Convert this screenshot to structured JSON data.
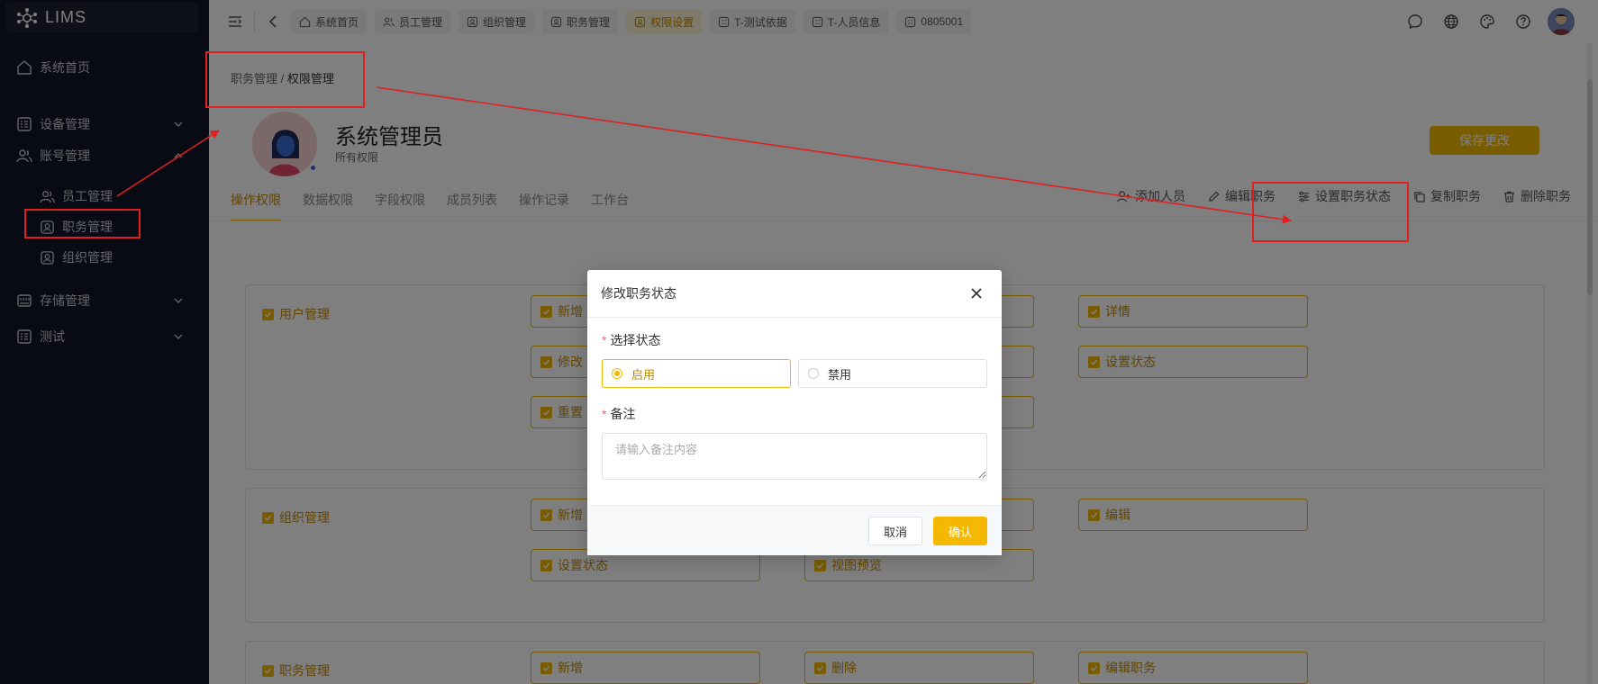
{
  "app": {
    "name": "LIMS"
  },
  "sidebar": {
    "items": [
      {
        "label": "系统首页"
      },
      {
        "label": "设备管理"
      },
      {
        "label": "账号管理"
      },
      {
        "label": "存储管理"
      },
      {
        "label": "测试"
      }
    ],
    "sub_items": [
      {
        "label": "员工管理"
      },
      {
        "label": "职务管理"
      },
      {
        "label": "组织管理"
      }
    ]
  },
  "topbar": {
    "tags": [
      {
        "label": "系统首页",
        "icon": "home-icon"
      },
      {
        "label": "员工管理",
        "icon": "users-icon"
      },
      {
        "label": "组织管理",
        "icon": "user-badge-icon"
      },
      {
        "label": "职务管理",
        "icon": "user-badge-icon"
      },
      {
        "label": "权限设置",
        "icon": "user-badge-icon",
        "active": true
      },
      {
        "label": "T-测试依据",
        "icon": "grid-icon"
      },
      {
        "label": "T-人员信息",
        "icon": "grid-icon"
      },
      {
        "label": "0805001",
        "icon": "grid-icon"
      }
    ]
  },
  "content": {
    "breadcrumb": {
      "parent": "职务管理",
      "separator": "/",
      "current": "权限管理"
    },
    "role": {
      "name": "系统管理员",
      "desc": "所有权限"
    },
    "save_label": "保存更改",
    "tabs": [
      "操作权限",
      "数据权限",
      "字段权限",
      "成员列表",
      "操作记录",
      "工作台"
    ],
    "actions": [
      {
        "label": "添加人员",
        "icon": "add-user-icon"
      },
      {
        "label": "编辑职务",
        "icon": "edit-icon"
      },
      {
        "label": "设置职务状态",
        "icon": "sliders-icon"
      },
      {
        "label": "复制职务",
        "icon": "copy-icon"
      },
      {
        "label": "删除职务",
        "icon": "trash-icon"
      }
    ],
    "groups": [
      {
        "title": "用户管理",
        "perms": [
          "新增",
          "",
          "详情",
          "修改",
          "",
          "设置状态",
          "重置",
          ""
        ]
      },
      {
        "title": "组织管理",
        "perms": [
          "新增",
          "",
          "编辑",
          "设置状态",
          "视图预览"
        ]
      },
      {
        "title": "职务管理",
        "perms": [
          "新增",
          "删除",
          "编辑职务"
        ]
      }
    ]
  },
  "dialog": {
    "title": "修改职务状态",
    "status_label": "选择状态",
    "required_mark": "*",
    "options": [
      {
        "label": "启用",
        "selected": true
      },
      {
        "label": "禁用",
        "selected": false
      }
    ],
    "remark_label": "备注",
    "remark_placeholder": "请输入备注内容",
    "cancel_label": "取消",
    "ok_label": "确认"
  },
  "colors": {
    "accent": "#f5b800",
    "sidebar_bg": "#101628",
    "annotation": "#e02020"
  }
}
